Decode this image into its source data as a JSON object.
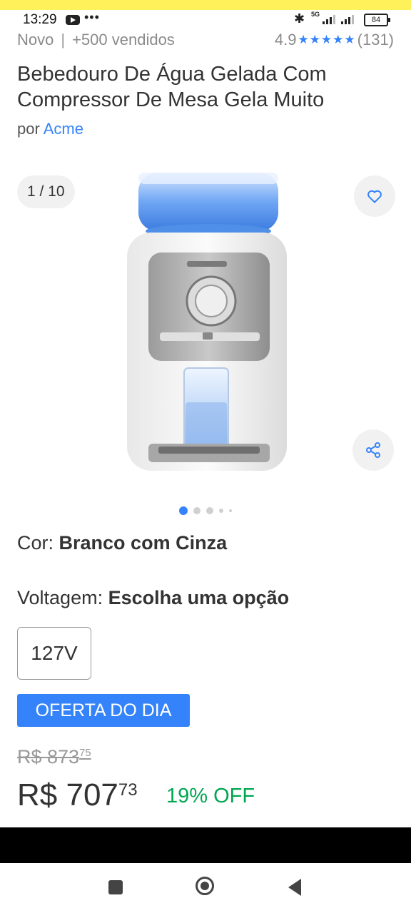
{
  "status_bar": {
    "time": "13:29",
    "icons": [
      "youtube-icon",
      "more-dots-icon",
      "bluetooth-icon",
      "signal-icon",
      "signal-icon",
      "battery-icon"
    ],
    "network_label": "5G",
    "battery": "84",
    "more": "•••",
    "bluetooth": "✱"
  },
  "product": {
    "condition": "Novo",
    "separator": "|",
    "sold": "+500 vendidos",
    "rating_value": "4.9",
    "stars": "★★★★★",
    "reviews_count": "(131)",
    "title": "Bebedouro De Água Gelada Com Compressor De Mesa Gela Muito",
    "seller_prefix": "por",
    "seller_name": "Acme"
  },
  "gallery": {
    "counter": "1 / 10",
    "total_images": 10,
    "current_index": 1,
    "accent_color": "#3483fa"
  },
  "variations": {
    "color_label": "Cor:",
    "color_value": "Branco com Cinza",
    "voltage_label": "Voltagem:",
    "voltage_value": "Escolha uma opção",
    "voltage_options": [
      "127V"
    ]
  },
  "pricing": {
    "deal_badge": "OFERTA DO DIA",
    "old_price_int": "R$ 873",
    "old_price_cents": "75",
    "price_int": "R$ 707",
    "price_cents": "73",
    "discount": "19% OFF",
    "discount_color": "#00a650"
  }
}
